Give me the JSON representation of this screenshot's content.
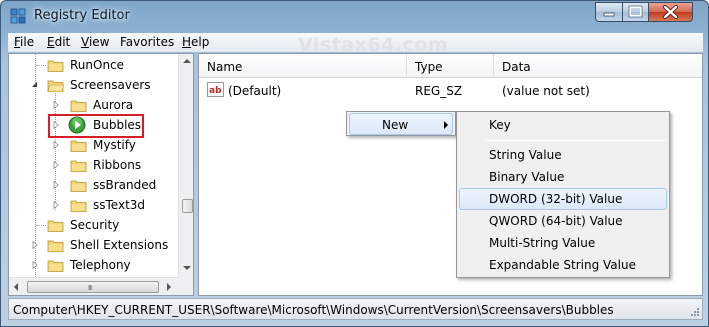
{
  "window": {
    "title": "Registry Editor",
    "watermark": "Vistax64.com"
  },
  "menubar": {
    "items": [
      {
        "label": "File",
        "mnemonic": "F",
        "rest": "ile"
      },
      {
        "label": "Edit",
        "mnemonic": "E",
        "rest": "dit"
      },
      {
        "label": "View",
        "mnemonic": "V",
        "rest": "iew"
      },
      {
        "label": "Favorites",
        "mnemonic": "",
        "rest": "Favorites"
      },
      {
        "label": "Help",
        "mnemonic": "H",
        "rest": "elp"
      }
    ]
  },
  "tree": {
    "items": [
      {
        "label": "RunOnce"
      },
      {
        "label": "Screensavers"
      },
      {
        "label": "Aurora"
      },
      {
        "label": "Bubbles"
      },
      {
        "label": "Mystify"
      },
      {
        "label": "Ribbons"
      },
      {
        "label": "ssBranded"
      },
      {
        "label": "ssText3d"
      },
      {
        "label": "Security"
      },
      {
        "label": "Shell Extensions"
      },
      {
        "label": "Telephony"
      }
    ],
    "scroll_grip": "III"
  },
  "list": {
    "columns": [
      "Name",
      "Type",
      "Data"
    ],
    "rows": [
      {
        "name": "(Default)",
        "type": "REG_SZ",
        "data": "(value not set)"
      }
    ]
  },
  "context_menu": {
    "new_label": "New",
    "submenu": {
      "key": "Key",
      "items": [
        "String Value",
        "Binary Value",
        "DWORD (32-bit) Value",
        "QWORD (64-bit) Value",
        "Multi-String Value",
        "Expandable String Value"
      ],
      "highlighted": "DWORD (32-bit) Value"
    }
  },
  "statusbar": {
    "path": "Computer\\HKEY_CURRENT_USER\\Software\\Microsoft\\Windows\\CurrentVersion\\Screensavers\\Bubbles"
  },
  "colors": {
    "highlight_box": "#d41f2a",
    "folder": "#e8c35a",
    "bubbles_icon": "#3aa33a"
  }
}
